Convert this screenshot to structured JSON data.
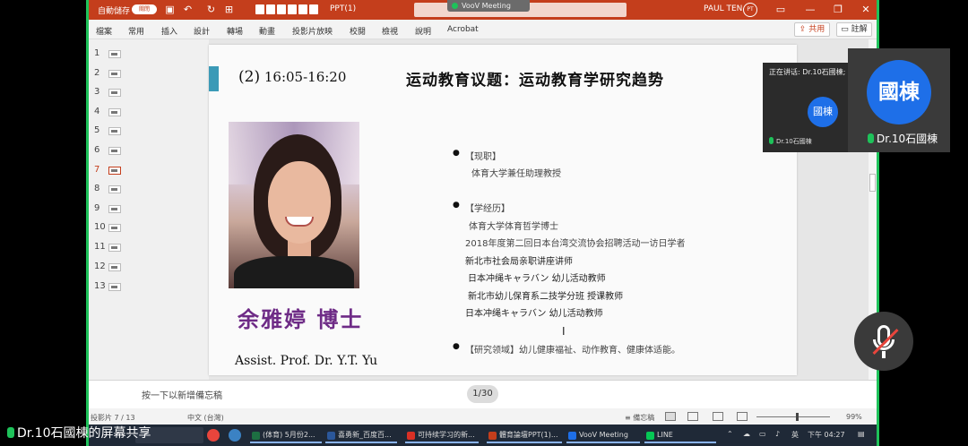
{
  "powerpoint": {
    "autosave_label": "自動儲存",
    "autosave_state": "關閉",
    "doc_title": "PPT(1)",
    "user_name": "PAUL TEN",
    "user_initials": "PT",
    "window_controls": [
      "—",
      "❐",
      "✕"
    ],
    "ribbon_tabs": [
      "檔案",
      "常用",
      "插入",
      "設計",
      "轉場",
      "動畫",
      "投影片放映",
      "校閱",
      "檢視",
      "說明",
      "Acrobat"
    ],
    "share_label": "共用",
    "comment_label": "註解",
    "thumbnails": [
      "1",
      "2",
      "3",
      "4",
      "5",
      "6",
      "7",
      "8",
      "9",
      "10",
      "11",
      "12",
      "13"
    ],
    "active_slide_index": 7,
    "notes_placeholder": "按一下以新增備忘稿",
    "page_indicator": "1/30",
    "status": {
      "slide_number": "投影片 7 / 13",
      "language": "中文 (台灣)",
      "notes_button": "備忘稿",
      "zoom": "99%"
    }
  },
  "slide": {
    "time_number": "(2)",
    "time_range": "16:05-16:20",
    "heading": "运动教育议题：运动教育学研究趋势",
    "name_cn": "余雅婷 博士",
    "name_en": "Assist. Prof. Dr. Y.T. Yu",
    "sections": [
      {
        "title": "【现职】",
        "lines": [
          "体育大学兼任助理教授"
        ]
      },
      {
        "title": "【学经历】",
        "lines": [
          "体育大学体育哲学博士",
          "2018年度第二回日本台湾交流协会招聘活动一访日学者",
          "新北市社会局亲职讲座讲师",
          "日本冲绳キャラバン 幼儿活动教师",
          "新北市幼儿保育系二技学分班 授课教师",
          "日本冲绳キャラバン 幼儿活动教师"
        ]
      },
      {
        "title": "【研究领域】",
        "inline": "幼儿健康福祉、动作教育、健康体适能。"
      }
    ]
  },
  "voov": {
    "pill_label": "VooV Meeting",
    "speaking_label": "正在讲话: Dr.10石國棟;",
    "small_avatar_text": "國棟",
    "small_name": "Dr.10石國棟",
    "big_avatar_text": "國棟",
    "big_name": "Dr.10石國棟",
    "share_caption": "Dr.10石國棟的屏幕共享"
  },
  "taskbar": {
    "tasks": [
      {
        "label": "(体育) 5月份2...",
        "color": "#1d6f42"
      },
      {
        "label": "喜勇新_百度百...",
        "color": "#2b579a"
      },
      {
        "label": "可持续学习的新...",
        "color": "#d93025"
      },
      {
        "label": "體育論壇PPT(1)...",
        "color": "#c43e1c"
      },
      {
        "label": "VooV Meeting",
        "color": "#1e6fe8"
      },
      {
        "label": "LINE",
        "color": "#06c755"
      }
    ],
    "ime": "英",
    "time": "下午 04:27"
  }
}
